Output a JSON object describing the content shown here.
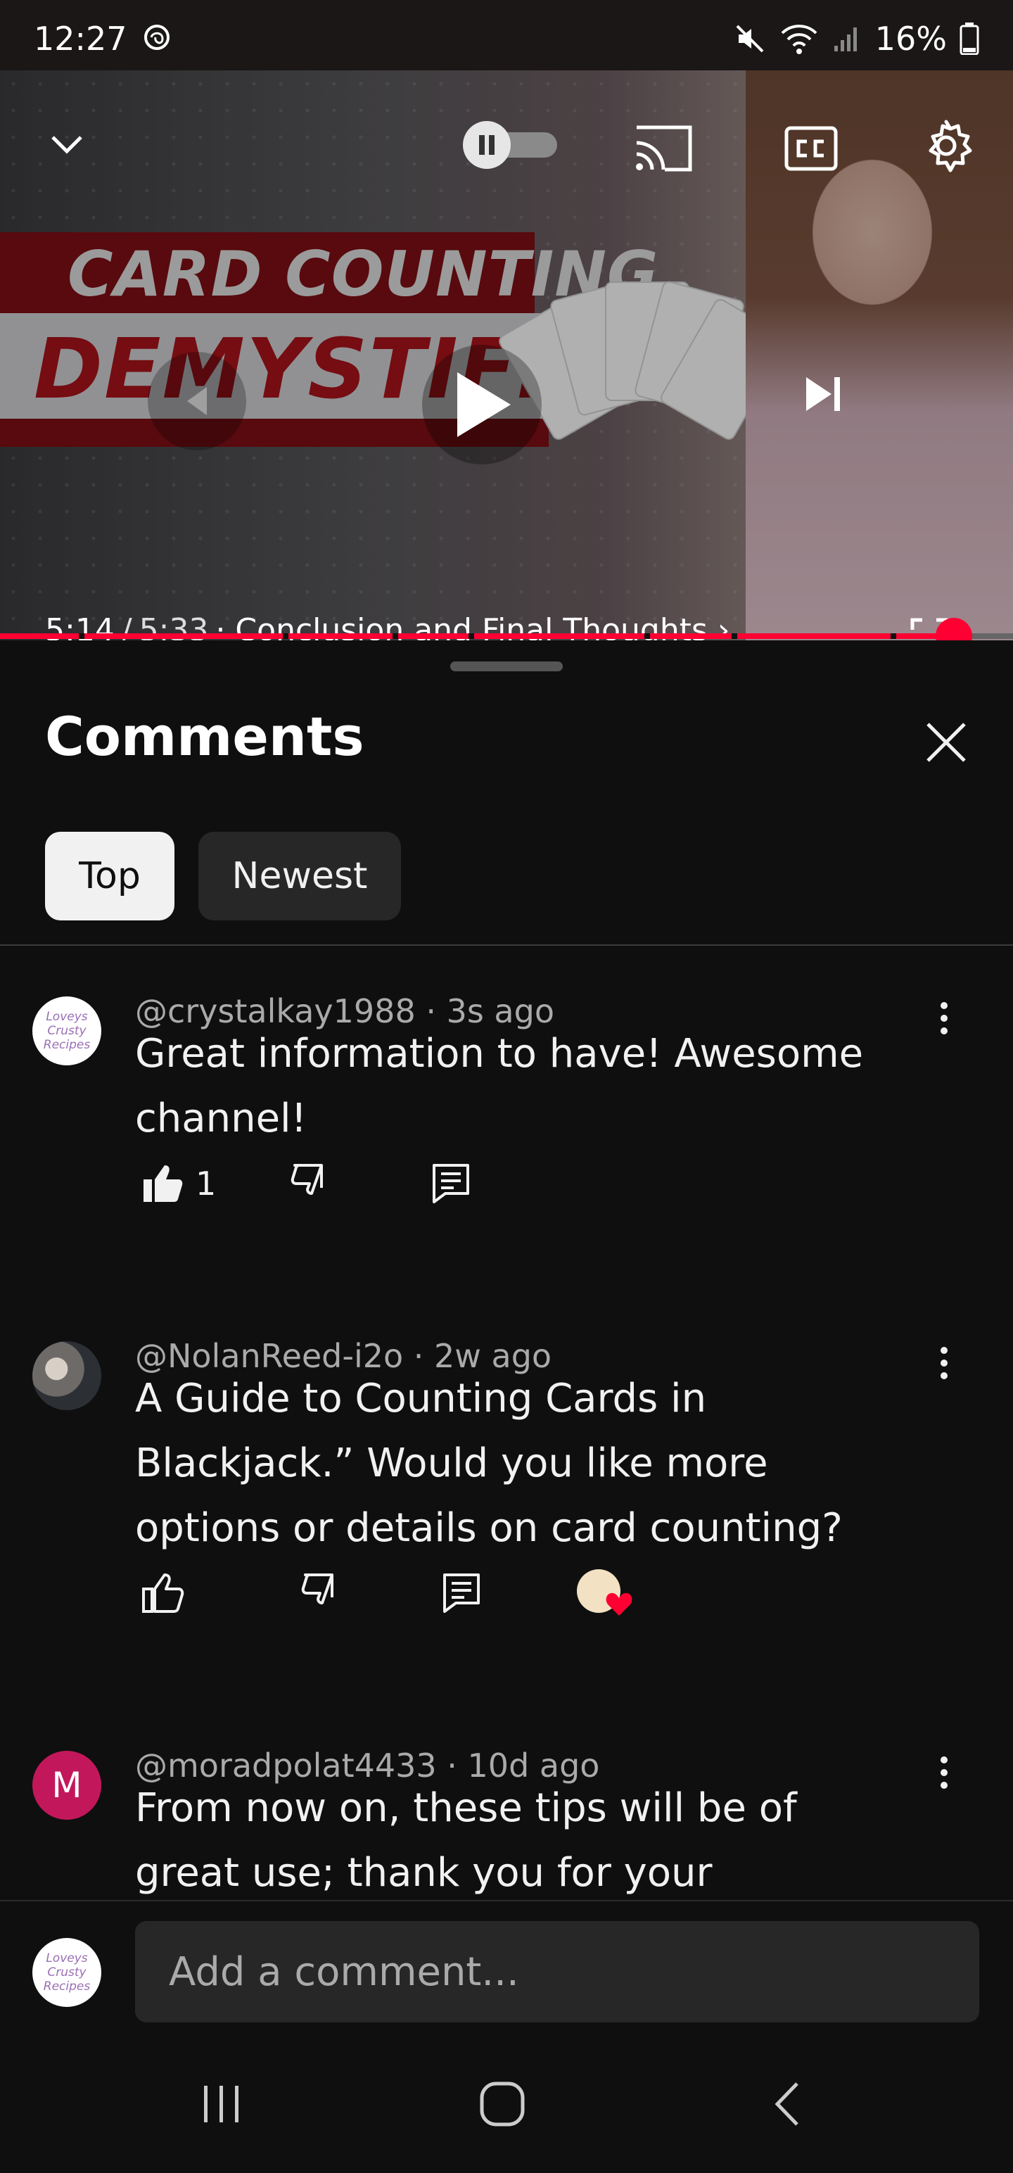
{
  "status_bar": {
    "time": "12:27",
    "battery": "16%",
    "icons": [
      "threads-icon",
      "mute-icon",
      "wifi-icon",
      "signal-icon",
      "battery-icon"
    ]
  },
  "player": {
    "thumbnail_text_line1": "CARD COUNTING",
    "thumbnail_text_line2": "DEMYSTIFIED",
    "current_time": "5:14",
    "separator": "/",
    "duration": "5:33",
    "chapter": "· Conclusion and Final Thoughts ›",
    "progress": 0.942,
    "autoplay_state": "on",
    "accent_color": "#ff0033"
  },
  "comments": {
    "title": "Comments",
    "tabs": [
      {
        "label": "Top",
        "selected": true
      },
      {
        "label": "Newest",
        "selected": false
      }
    ],
    "items": [
      {
        "author": "@crystalkay1988",
        "age": "· 3s ago",
        "meta": "@crystalkay1988 · 3s ago",
        "text": "Great information to have! Awesome channel!",
        "likes": "1",
        "avatar_text": "Loveys Crusty Recipes",
        "liked": true
      },
      {
        "author": "@NolanReed-i2o",
        "meta": "@NolanReed-i2o · 2w ago",
        "text": "A Guide to Counting Cards in Blackjack.” Would you like more options or details on card counting?",
        "creator_hearted": true
      },
      {
        "author": "@moradpolat4433",
        "meta": "@moradpolat4433 · 10d ago",
        "text": "From now on, these tips will be of great use; thank you for your information and",
        "avatar_letter": "M",
        "avatar_color": "#c2185b"
      }
    ],
    "compose_placeholder": "Add a comment...",
    "compose_avatar_text": "Loveys Crusty Recipes"
  }
}
